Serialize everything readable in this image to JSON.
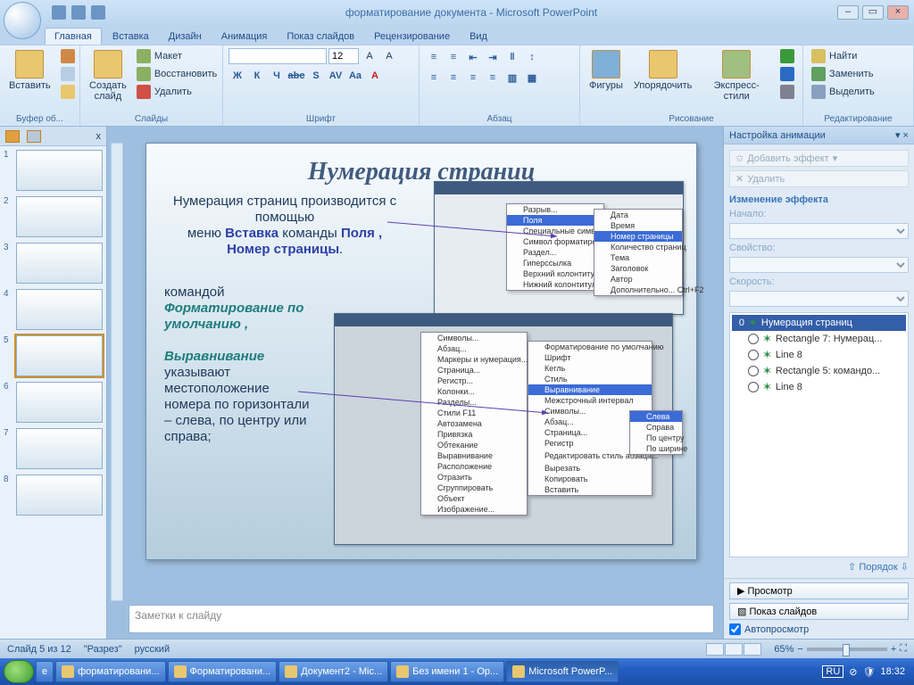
{
  "title": "форматирование документа - Microsoft PowerPoint",
  "tabs": [
    "Главная",
    "Вставка",
    "Дизайн",
    "Анимация",
    "Показ слайдов",
    "Рецензирование",
    "Вид"
  ],
  "activeTab": 0,
  "ribbon": {
    "clipboard": {
      "paste": "Вставить",
      "label": "Буфер об..."
    },
    "slides": {
      "new": "Создать\nслайд",
      "layout": "Макет",
      "restore": "Восстановить",
      "delete": "Удалить",
      "label": "Слайды"
    },
    "font": {
      "name": "",
      "size": "12",
      "label": "Шрифт",
      "buttons": [
        "Ж",
        "К",
        "Ч",
        "abc",
        "S",
        "AV",
        "Aa",
        "A"
      ]
    },
    "para": {
      "label": "Абзац"
    },
    "draw": {
      "shapes": "Фигуры",
      "arrange": "Упорядочить",
      "styles": "Экспресс-стили",
      "label": "Рисование"
    },
    "edit": {
      "find": "Найти",
      "replace": "Заменить",
      "select": "Выделить",
      "label": "Редактирование"
    }
  },
  "outline": {
    "closeX": "x",
    "count": 8,
    "selected": 5
  },
  "slide": {
    "title": "Нумерация страниц",
    "p1a": "Нумерация страниц производится с помощью",
    "p1b": "меню ",
    "p1c": "Вставка",
    "p1d": " команды ",
    "p1e": "Поля ,",
    "p1f": "Номер страницы",
    "p2a": "командой",
    "p2b": "Форматирование по умолчанию ,",
    "p3a": "Выравнивание",
    "p3b": "указывают местоположение номера по горизонтали – слева, по центру или справа;",
    "notes": "Заметки к слайду"
  },
  "embeddedMenu1": [
    "Разрыв...",
    "Поля",
    "Специальные символы...",
    "Символ форматирования",
    "Раздел...",
    "Гиперссылка",
    "Верхний колонтитул",
    "Нижний колонтитул"
  ],
  "embeddedMenu1b": [
    "Дата",
    "Время",
    "Номер страницы",
    "Количество страниц",
    "Тема",
    "Заголовок",
    "Автор",
    "Дополнительно...  Ctrl+F2"
  ],
  "embeddedMenu2": [
    "Символы...",
    "Абзац...",
    "Маркеры и нумерация...",
    "Страница...",
    "Регистр...",
    "Колонки...",
    "Разделы...",
    "Стили        F11",
    "Автозамена",
    "Привязка",
    "Обтекание",
    "Выравнивание",
    "Расположение",
    "Отразить",
    "Сгруппировать",
    "Объект",
    "Изображение..."
  ],
  "embeddedMenu2b": [
    "Форматирование по умолчанию",
    "Шрифт",
    "Кегль",
    "Стиль",
    "Выравнивание",
    "Межстрочный интервал",
    "Символы...",
    "Абзац...",
    "Страница...",
    "Регистр",
    "",
    "Редактировать стиль абзаца...",
    "",
    "Вырезать",
    "Копировать",
    "Вставить"
  ],
  "embeddedMenu2c": [
    "Слева",
    "Справа",
    "По центру",
    "По ширине"
  ],
  "animPane": {
    "title": "Настройка анимации",
    "addEffect": "Добавить эффект",
    "remove": "Удалить",
    "changeHeader": "Изменение эффекта",
    "start": "Начало:",
    "property": "Свойство:",
    "speed": "Скорость:",
    "effects": [
      {
        "lead": "0",
        "name": "Нумерация страниц"
      },
      {
        "lead": "",
        "name": "Rectangle 7: Нумерац..."
      },
      {
        "lead": "",
        "name": "Line 8"
      },
      {
        "lead": "",
        "name": "Rectangle 5:  командо..."
      },
      {
        "lead": "",
        "name": "Line 8"
      }
    ],
    "order": "Порядок",
    "preview": "Просмотр",
    "slideshow": "Показ слайдов",
    "autoplay": "Автопросмотр"
  },
  "status": {
    "slide": "Слайд 5 из 12",
    "theme": "\"Разрез\"",
    "lang": "русский",
    "zoom": "65%"
  },
  "taskbar": {
    "items": [
      "форматировани...",
      "Форматировани...",
      "Документ2 - Mic...",
      "Без имени 1 - Op...",
      "Microsoft PowerP..."
    ],
    "lang": "RU",
    "time": "18:32"
  }
}
